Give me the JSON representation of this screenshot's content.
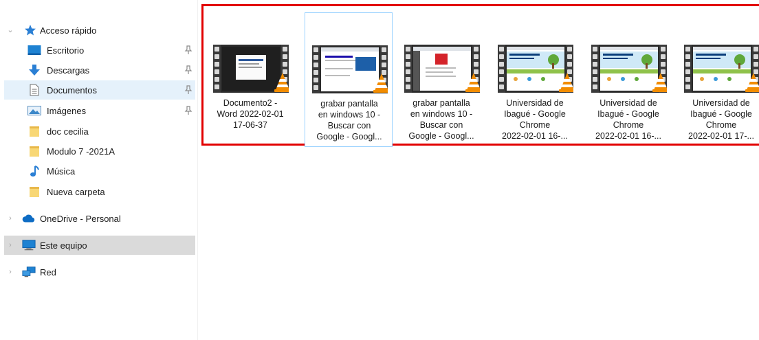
{
  "nav": {
    "quick_access": "Acceso rápido",
    "items": [
      {
        "label": "Escritorio",
        "pinned": true
      },
      {
        "label": "Descargas",
        "pinned": true
      },
      {
        "label": "Documentos",
        "pinned": true,
        "selected": true
      },
      {
        "label": "Imágenes",
        "pinned": true
      },
      {
        "label": "doc cecilia"
      },
      {
        "label": "Modulo 7 -2021A"
      },
      {
        "label": "Música"
      },
      {
        "label": "Nueva carpeta"
      }
    ],
    "onedrive": "OneDrive - Personal",
    "this_pc": "Este equipo",
    "network": "Red"
  },
  "files": [
    {
      "lines": [
        "Documento2 -",
        "Word 2022-02-01",
        "17-06-37"
      ],
      "thumb": "word"
    },
    {
      "lines": [
        "grabar pantalla",
        "en windows 10 -",
        "Buscar con",
        "Google - Googl..."
      ],
      "thumb": "google",
      "selected": true
    },
    {
      "lines": [
        "grabar pantalla",
        "en windows 10 -",
        "Buscar con",
        "Google - Googl..."
      ],
      "thumb": "google-red"
    },
    {
      "lines": [
        "Universidad de",
        "Ibagué - Google",
        "Chrome",
        "2022-02-01 16-..."
      ],
      "thumb": "uni"
    },
    {
      "lines": [
        "Universidad de",
        "Ibagué - Google",
        "Chrome",
        "2022-02-01 16-..."
      ],
      "thumb": "uni"
    },
    {
      "lines": [
        "Universidad de",
        "Ibagué - Google",
        "Chrome",
        "2022-02-01 17-..."
      ],
      "thumb": "uni"
    }
  ],
  "colors": {
    "highlight_border": "#e20000",
    "selected_bg": "#e5f1fb",
    "hover_bg": "#dadada"
  }
}
